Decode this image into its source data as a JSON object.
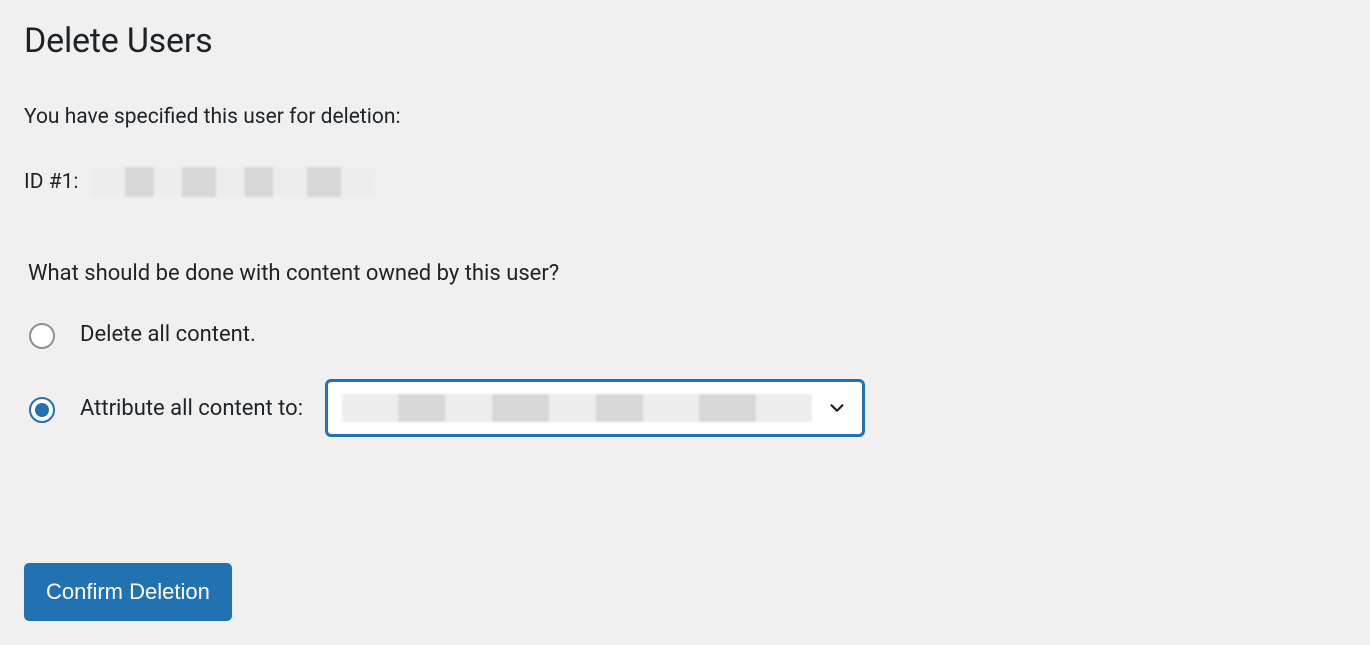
{
  "page": {
    "title": "Delete Users"
  },
  "intro": "You have specified this user for deletion:",
  "user": {
    "id_label": "ID #1:",
    "name_redacted": true
  },
  "content_question": "What should be done with content owned by this user?",
  "options": {
    "delete": {
      "label": "Delete all content.",
      "checked": false
    },
    "attribute": {
      "label": "Attribute all content to:",
      "checked": true,
      "select_value_redacted": true
    }
  },
  "actions": {
    "confirm_label": "Confirm Deletion"
  }
}
